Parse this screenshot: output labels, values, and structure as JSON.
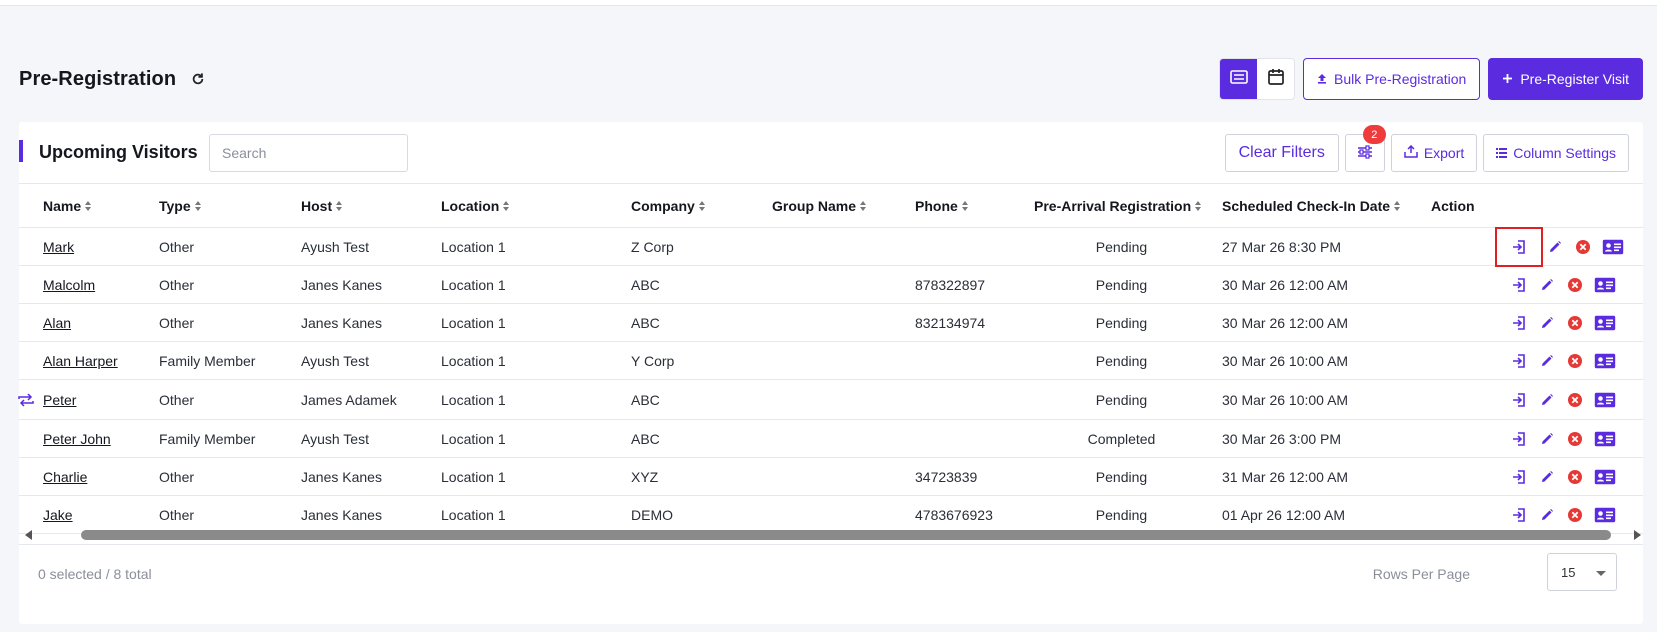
{
  "header": {
    "title": "Pre-Registration",
    "bulk_label": "Bulk Pre-Registration",
    "pre_register_label": "Pre-Register Visit"
  },
  "card": {
    "title": "Upcoming Visitors",
    "search_placeholder": "Search",
    "clear_filters_label": "Clear Filters",
    "filter_badge": "2",
    "export_label": "Export",
    "column_settings_label": "Column Settings"
  },
  "table": {
    "columns": [
      "Name",
      "Type",
      "Host",
      "Location",
      "Company",
      "Group Name",
      "Phone",
      "Pre-Arrival Registration",
      "Scheduled Check-In Date",
      "Action"
    ],
    "rows": [
      {
        "name": "Mark",
        "type": "Other",
        "host": "Ayush Test",
        "location": "Location 1",
        "company": "Z Corp",
        "group": "",
        "phone": "",
        "pre_arrival": "Pending",
        "checkin": "27 Mar 26 8:30 PM"
      },
      {
        "name": "Malcolm",
        "type": "Other",
        "host": "Janes Kanes",
        "location": "Location 1",
        "company": "ABC",
        "group": "",
        "phone": "878322897",
        "pre_arrival": "Pending",
        "checkin": "30 Mar 26 12:00 AM"
      },
      {
        "name": "Alan",
        "type": "Other",
        "host": "Janes Kanes",
        "location": "Location 1",
        "company": "ABC",
        "group": "",
        "phone": "832134974",
        "pre_arrival": "Pending",
        "checkin": "30 Mar 26 12:00 AM"
      },
      {
        "name": "Alan Harper",
        "type": "Family Member",
        "host": "Ayush Test",
        "location": "Location 1",
        "company": "Y Corp",
        "group": "",
        "phone": "",
        "pre_arrival": "Pending",
        "checkin": "30 Mar 26 10:00 AM"
      },
      {
        "name": "Peter",
        "type": "Other",
        "host": "James Adamek",
        "location": "Location 1",
        "company": "ABC",
        "group": "",
        "phone": "",
        "pre_arrival": "Pending",
        "checkin": "30 Mar 26 10:00 AM"
      },
      {
        "name": "Peter John",
        "type": "Family Member",
        "host": "Ayush Test",
        "location": "Location 1",
        "company": "ABC",
        "group": "",
        "phone": "",
        "pre_arrival": "Completed",
        "checkin": "30 Mar 26 3:00 PM"
      },
      {
        "name": "Charlie",
        "type": "Other",
        "host": "Janes Kanes",
        "location": "Location 1",
        "company": "XYZ",
        "group": "",
        "phone": "34723839",
        "pre_arrival": "Pending",
        "checkin": "31 Mar 26 12:00 AM"
      },
      {
        "name": "Jake",
        "type": "Other",
        "host": "Janes Kanes",
        "location": "Location 1",
        "company": "DEMO",
        "group": "",
        "phone": "4783676923",
        "pre_arrival": "Pending",
        "checkin": "01 Apr 26 12:00 AM"
      }
    ]
  },
  "footer": {
    "selection_text": "0 selected / 8 total",
    "rows_per_page_label": "Rows Per Page",
    "rows_per_page_value": "15"
  },
  "colors": {
    "accent": "#5b2be0",
    "danger": "#e53935",
    "highlight": "#e02020"
  }
}
